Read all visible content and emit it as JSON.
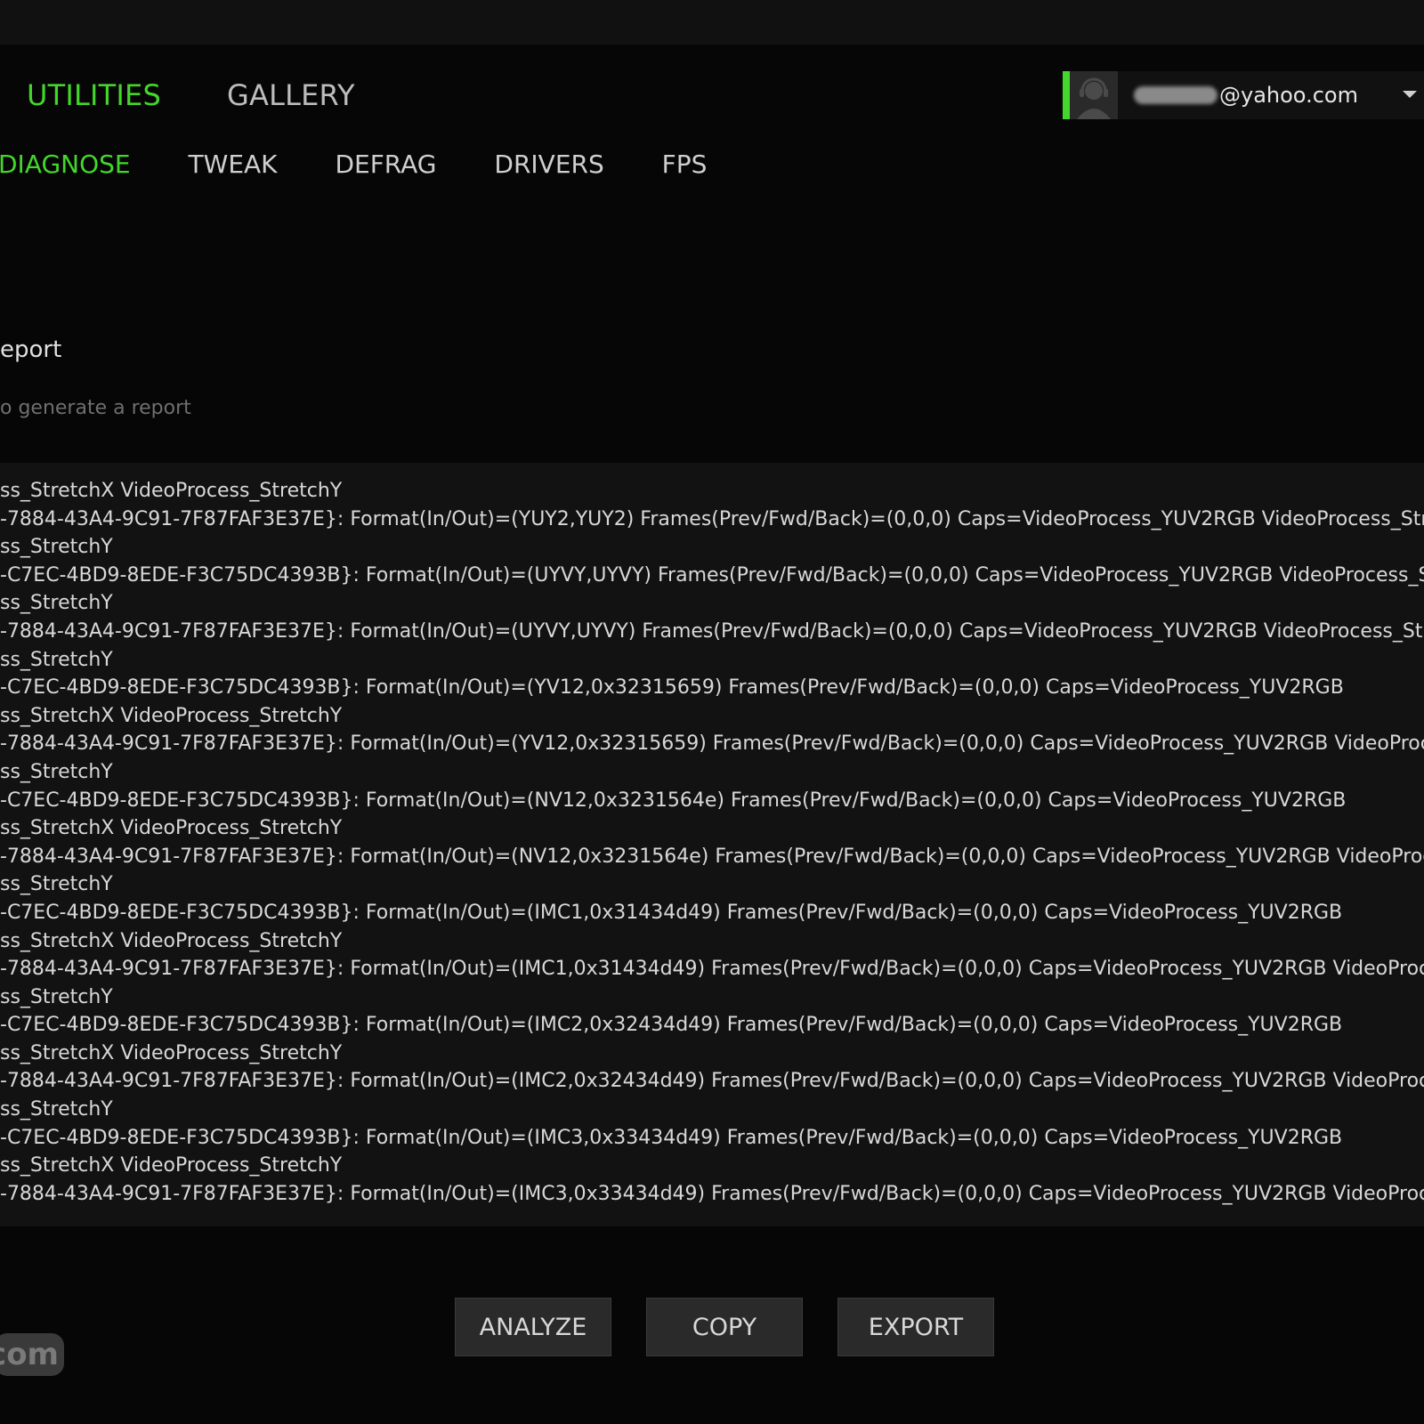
{
  "main_nav": [
    {
      "label": "UTILITIES",
      "active": true
    },
    {
      "label": "GALLERY",
      "active": false
    }
  ],
  "sub_nav": [
    {
      "label": "DIAGNOSE",
      "active": true
    },
    {
      "label": "TWEAK",
      "active": false
    },
    {
      "label": "DEFRAG",
      "active": false
    },
    {
      "label": "DRIVERS",
      "active": false
    },
    {
      "label": "FPS",
      "active": false
    }
  ],
  "account": {
    "email_visible": "@yahoo.com",
    "accent_color": "#44d62c"
  },
  "report": {
    "title": "eport",
    "hint": "o generate a report"
  },
  "log": [
    "ss_StretchX VideoProcess_StretchY",
    "-7884-43A4-9C91-7F87FAF3E37E}: Format(In/Out)=(YUY2,YUY2) Frames(Prev/Fwd/Back)=(0,0,0) Caps=VideoProcess_YUV2RGB VideoProcess_Stre",
    "ss_StretchY",
    "-C7EC-4BD9-8EDE-F3C75DC4393B}: Format(In/Out)=(UYVY,UYVY) Frames(Prev/Fwd/Back)=(0,0,0) Caps=VideoProcess_YUV2RGB VideoProcess_S",
    "ss_StretchY",
    "-7884-43A4-9C91-7F87FAF3E37E}: Format(In/Out)=(UYVY,UYVY) Frames(Prev/Fwd/Back)=(0,0,0) Caps=VideoProcess_YUV2RGB VideoProcess_Stre",
    "ss_StretchY",
    "-C7EC-4BD9-8EDE-F3C75DC4393B}: Format(In/Out)=(YV12,0x32315659) Frames(Prev/Fwd/Back)=(0,0,0) Caps=VideoProcess_YUV2RGB",
    "ss_StretchX VideoProcess_StretchY",
    "-7884-43A4-9C91-7F87FAF3E37E}: Format(In/Out)=(YV12,0x32315659) Frames(Prev/Fwd/Back)=(0,0,0) Caps=VideoProcess_YUV2RGB VideoProce",
    "ss_StretchY",
    "-C7EC-4BD9-8EDE-F3C75DC4393B}: Format(In/Out)=(NV12,0x3231564e) Frames(Prev/Fwd/Back)=(0,0,0) Caps=VideoProcess_YUV2RGB",
    "ss_StretchX VideoProcess_StretchY",
    "-7884-43A4-9C91-7F87FAF3E37E}: Format(In/Out)=(NV12,0x3231564e) Frames(Prev/Fwd/Back)=(0,0,0) Caps=VideoProcess_YUV2RGB VideoProce",
    "ss_StretchY",
    "-C7EC-4BD9-8EDE-F3C75DC4393B}: Format(In/Out)=(IMC1,0x31434d49) Frames(Prev/Fwd/Back)=(0,0,0) Caps=VideoProcess_YUV2RGB",
    "ss_StretchX VideoProcess_StretchY",
    "-7884-43A4-9C91-7F87FAF3E37E}: Format(In/Out)=(IMC1,0x31434d49) Frames(Prev/Fwd/Back)=(0,0,0) Caps=VideoProcess_YUV2RGB VideoProce",
    "ss_StretchY",
    "-C7EC-4BD9-8EDE-F3C75DC4393B}: Format(In/Out)=(IMC2,0x32434d49) Frames(Prev/Fwd/Back)=(0,0,0) Caps=VideoProcess_YUV2RGB",
    "ss_StretchX VideoProcess_StretchY",
    "-7884-43A4-9C91-7F87FAF3E37E}: Format(In/Out)=(IMC2,0x32434d49) Frames(Prev/Fwd/Back)=(0,0,0) Caps=VideoProcess_YUV2RGB VideoProce",
    "ss_StretchY",
    "-C7EC-4BD9-8EDE-F3C75DC4393B}: Format(In/Out)=(IMC3,0x33434d49) Frames(Prev/Fwd/Back)=(0,0,0) Caps=VideoProcess_YUV2RGB",
    "ss_StretchX VideoProcess_StretchY",
    "-7884-43A4-9C91-7F87FAF3E37E}: Format(In/Out)=(IMC3,0x33434d49) Frames(Prev/Fwd/Back)=(0,0,0) Caps=VideoProcess_YUV2RGB VideoProce"
  ],
  "buttons": {
    "analyze": "ANALYZE",
    "copy": "COPY",
    "export": "EXPORT"
  },
  "watermark": {
    "text": "com"
  }
}
